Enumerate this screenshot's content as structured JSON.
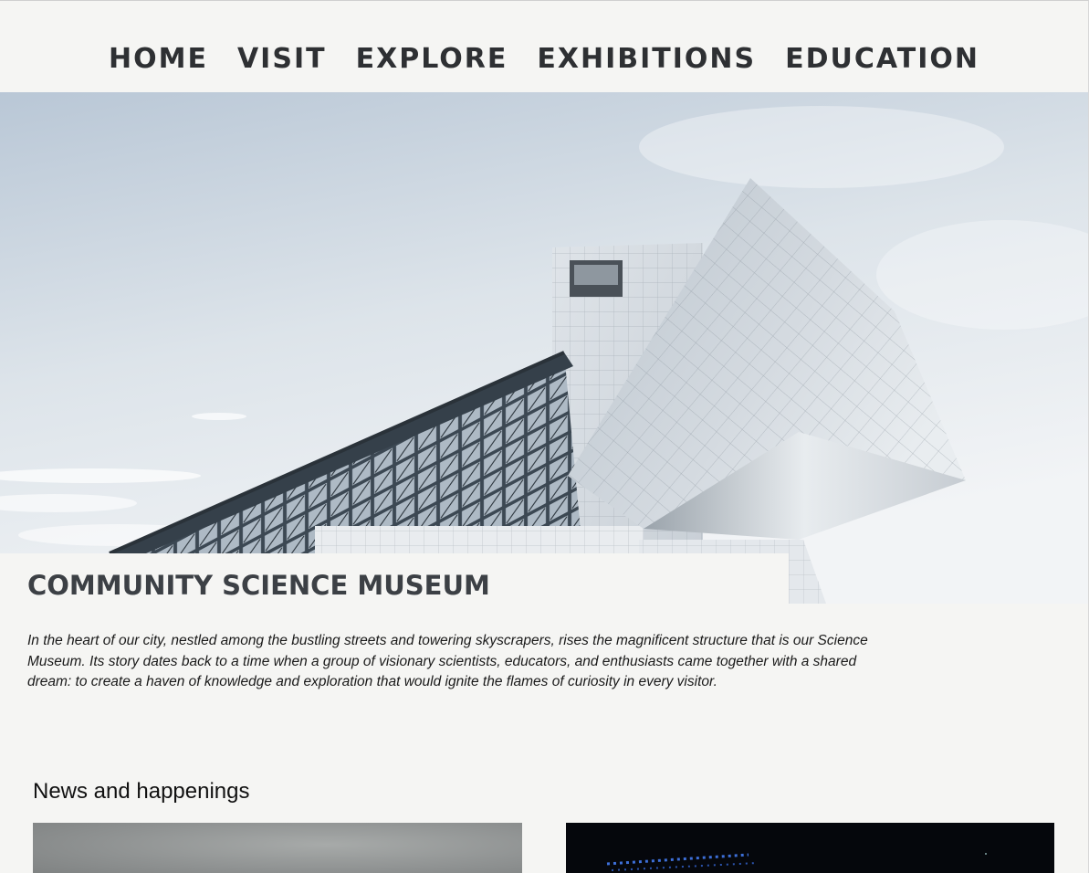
{
  "nav": {
    "items": [
      {
        "label": "HOME"
      },
      {
        "label": "VISIT"
      },
      {
        "label": "EXPLORE"
      },
      {
        "label": "EXHIBITIONS"
      },
      {
        "label": "EDUCATION"
      }
    ]
  },
  "hero": {
    "image_icon": "museum-building-photo"
  },
  "main": {
    "title": "COMMUNITY SCIENCE MUSEUM",
    "intro": "In the heart of our city, nestled among the bustling streets and towering skyscrapers, rises the magnificent structure that is our Science Museum. Its story dates back to a time when a group of visionary scientists, educators, and enthusiasts came together with a shared dream: to create a haven of knowledge and exploration that would ignite the flames of curiosity in every visitor."
  },
  "news": {
    "heading": "News and happenings",
    "cards": [
      {
        "image_icon": "grey-photo"
      },
      {
        "image_icon": "dark-photo"
      }
    ]
  },
  "colors": {
    "page_background": "#f5f5f3",
    "nav_text": "#2e3033",
    "title_text": "#3c4045"
  }
}
